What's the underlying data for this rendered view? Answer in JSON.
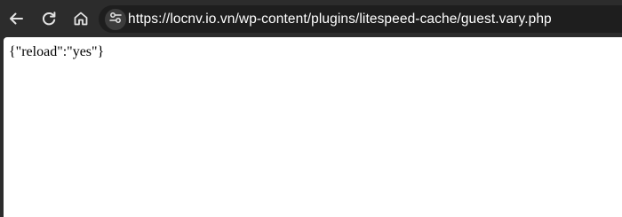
{
  "browser": {
    "toolbar": {
      "back_icon": "arrow-left-icon",
      "reload_icon": "reload-icon",
      "home_icon": "home-icon",
      "site_info_icon": "tune-icon"
    },
    "address_bar": {
      "url": "https://locnv.io.vn/wp-content/plugins/litespeed-cache/guest.vary.php"
    },
    "colors": {
      "chrome_bg": "#2c2c2c",
      "omnibox_bg": "#1e1e1e",
      "url_text": "#ffffff",
      "icon": "#e3e3e3",
      "page_bg": "#ffffff"
    }
  },
  "page": {
    "body_text": "{\"reload\":\"yes\"}"
  }
}
